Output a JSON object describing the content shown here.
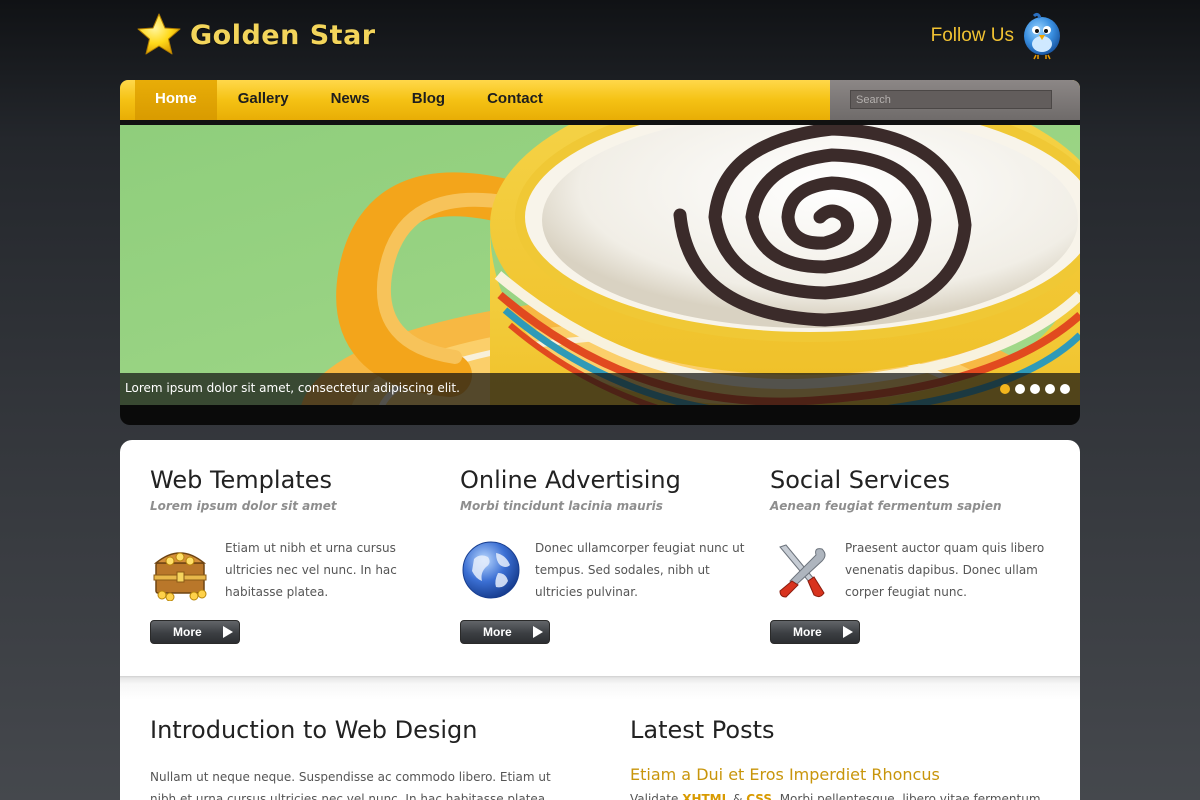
{
  "header": {
    "logo_text": "Golden Star",
    "follow_text": "Follow Us"
  },
  "nav": {
    "items": [
      {
        "label": "Home",
        "active": true
      },
      {
        "label": "Gallery"
      },
      {
        "label": "News"
      },
      {
        "label": "Blog"
      },
      {
        "label": "Contact"
      }
    ],
    "search_placeholder": "Search"
  },
  "slider": {
    "caption": "Lorem ipsum dolor sit amet, consectetur adipiscing elit.",
    "slide_count": 5,
    "active_slide": 1
  },
  "features": [
    {
      "title": "Web Templates",
      "subtitle": "Lorem ipsum dolor sit amet",
      "icon": "treasure-chest-icon",
      "text": "Etiam ut nibh et urna cursus ultricies nec vel nunc. In hac habitasse platea.",
      "button": "More"
    },
    {
      "title": "Online Advertising",
      "subtitle": "Morbi tincidunt lacinia mauris",
      "icon": "globe-icon",
      "text": "Donec ullamcorper feugiat nunc ut tempus. Sed sodales, nibh ut ultricies pulvinar.",
      "button": "More"
    },
    {
      "title": "Social Services",
      "subtitle": "Aenean feugiat fermentum sapien",
      "icon": "tools-icon",
      "text": "Praesent auctor quam quis libero venenatis dapibus. Donec ullam corper feugiat nunc.",
      "button": "More"
    }
  ],
  "intro": {
    "title": "Introduction to Web Design",
    "text": "Nullam ut neque neque. Suspendisse ac commodo libero. Etiam ut nibh et urna cursus ultricies nec vel nunc. In hac habitasse platea dictumst."
  },
  "latest": {
    "title": "Latest Posts",
    "post_title": "Etiam a Dui et Eros Imperdiet Rhoncus",
    "post_prefix": "Validate",
    "post_xhtml": "XHTML",
    "post_amp": "&",
    "post_css": "CSS",
    "post_rest": ". Morbi pellentesque, libero vitae fermentum"
  },
  "colors": {
    "accent": "#f5c214",
    "logo": "#f3d55b",
    "link": "#c8950b"
  }
}
